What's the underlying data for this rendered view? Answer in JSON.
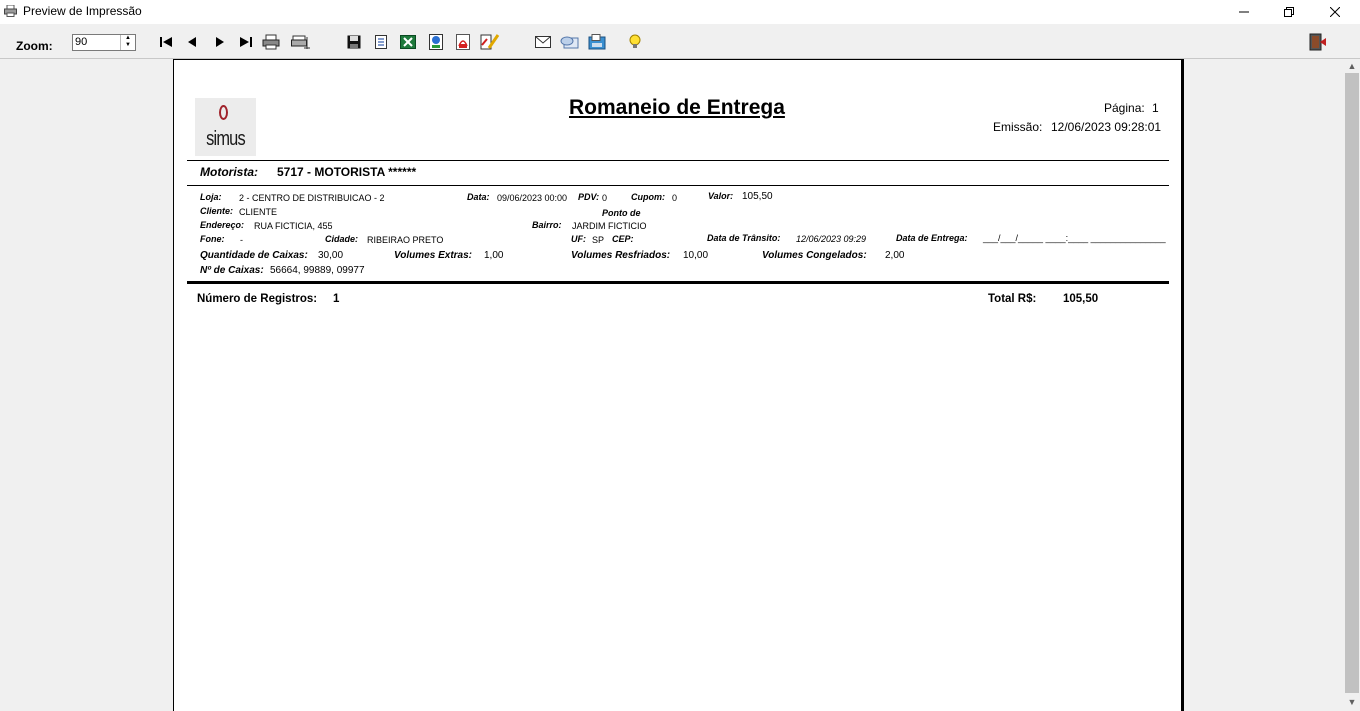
{
  "window": {
    "title": "Preview de Impressão"
  },
  "toolbar": {
    "zoom_label": "Zoom:",
    "zoom_value": "90"
  },
  "report": {
    "title": "Romaneio de Entrega",
    "logo_text": "simus",
    "page_label": "Página:",
    "page_number": "1",
    "emission_label": "Emissão:",
    "emission_value": "12/06/2023 09:28:01",
    "driver_label": "Motorista:",
    "driver_value": "5717 - MOTORISTA ******",
    "loja_label": "Loja:",
    "loja_value": "2 - CENTRO DE DISTRIBUICAO - 2",
    "data_label": "Data:",
    "data_value": "09/06/2023 00:00",
    "pdv_label": "PDV:",
    "pdv_value": "0",
    "cupom_label": "Cupom:",
    "cupom_value": "0",
    "valor_label": "Valor:",
    "valor_value": "105,50",
    "cliente_label": "Cliente:",
    "cliente_value": "CLIENTE",
    "ponto_label": "Ponto de",
    "endereco_label": "Endereço:",
    "endereco_value": "RUA FICTICIA, 455",
    "bairro_label": "Bairro:",
    "bairro_value": "JARDIM FICTICIO",
    "fone_label": "Fone:",
    "fone_value": "-",
    "cidade_label": "Cidade:",
    "cidade_value": "RIBEIRAO PRETO",
    "uf_label": "UF:",
    "uf_value": "SP",
    "cep_label": "CEP:",
    "transito_label": "Data de Trânsito:",
    "transito_value": "12/06/2023 09:29",
    "entrega_label": "Data de Entrega:",
    "entrega_value": "___/___/_____ ____:____ _______________",
    "qtd_caixas_label": "Quantidade de Caixas:",
    "qtd_caixas_value": "30,00",
    "vol_extras_label": "Volumes Extras:",
    "vol_extras_value": "1,00",
    "vol_resf_label": "Volumes Resfriados:",
    "vol_resf_value": "10,00",
    "vol_cong_label": "Volumes Congelados:",
    "vol_cong_value": "2,00",
    "num_caixas_label": "Nº de Caixas:",
    "num_caixas_value": "56664, 99889, 09977",
    "registros_label": "Número de Registros:",
    "registros_value": "1",
    "total_label": "Total R$:",
    "total_value": "105,50"
  },
  "icons": [
    "printer-app-icon",
    "first-page-icon",
    "prev-page-icon",
    "next-page-icon",
    "last-page-icon",
    "print-icon",
    "print-setup-icon",
    "save-icon",
    "export-text-icon",
    "export-excel-icon",
    "export-html-icon",
    "export-pdf-icon",
    "edit-icon",
    "email-icon",
    "email-send-icon",
    "fax-icon",
    "hint-icon",
    "exit-icon"
  ]
}
